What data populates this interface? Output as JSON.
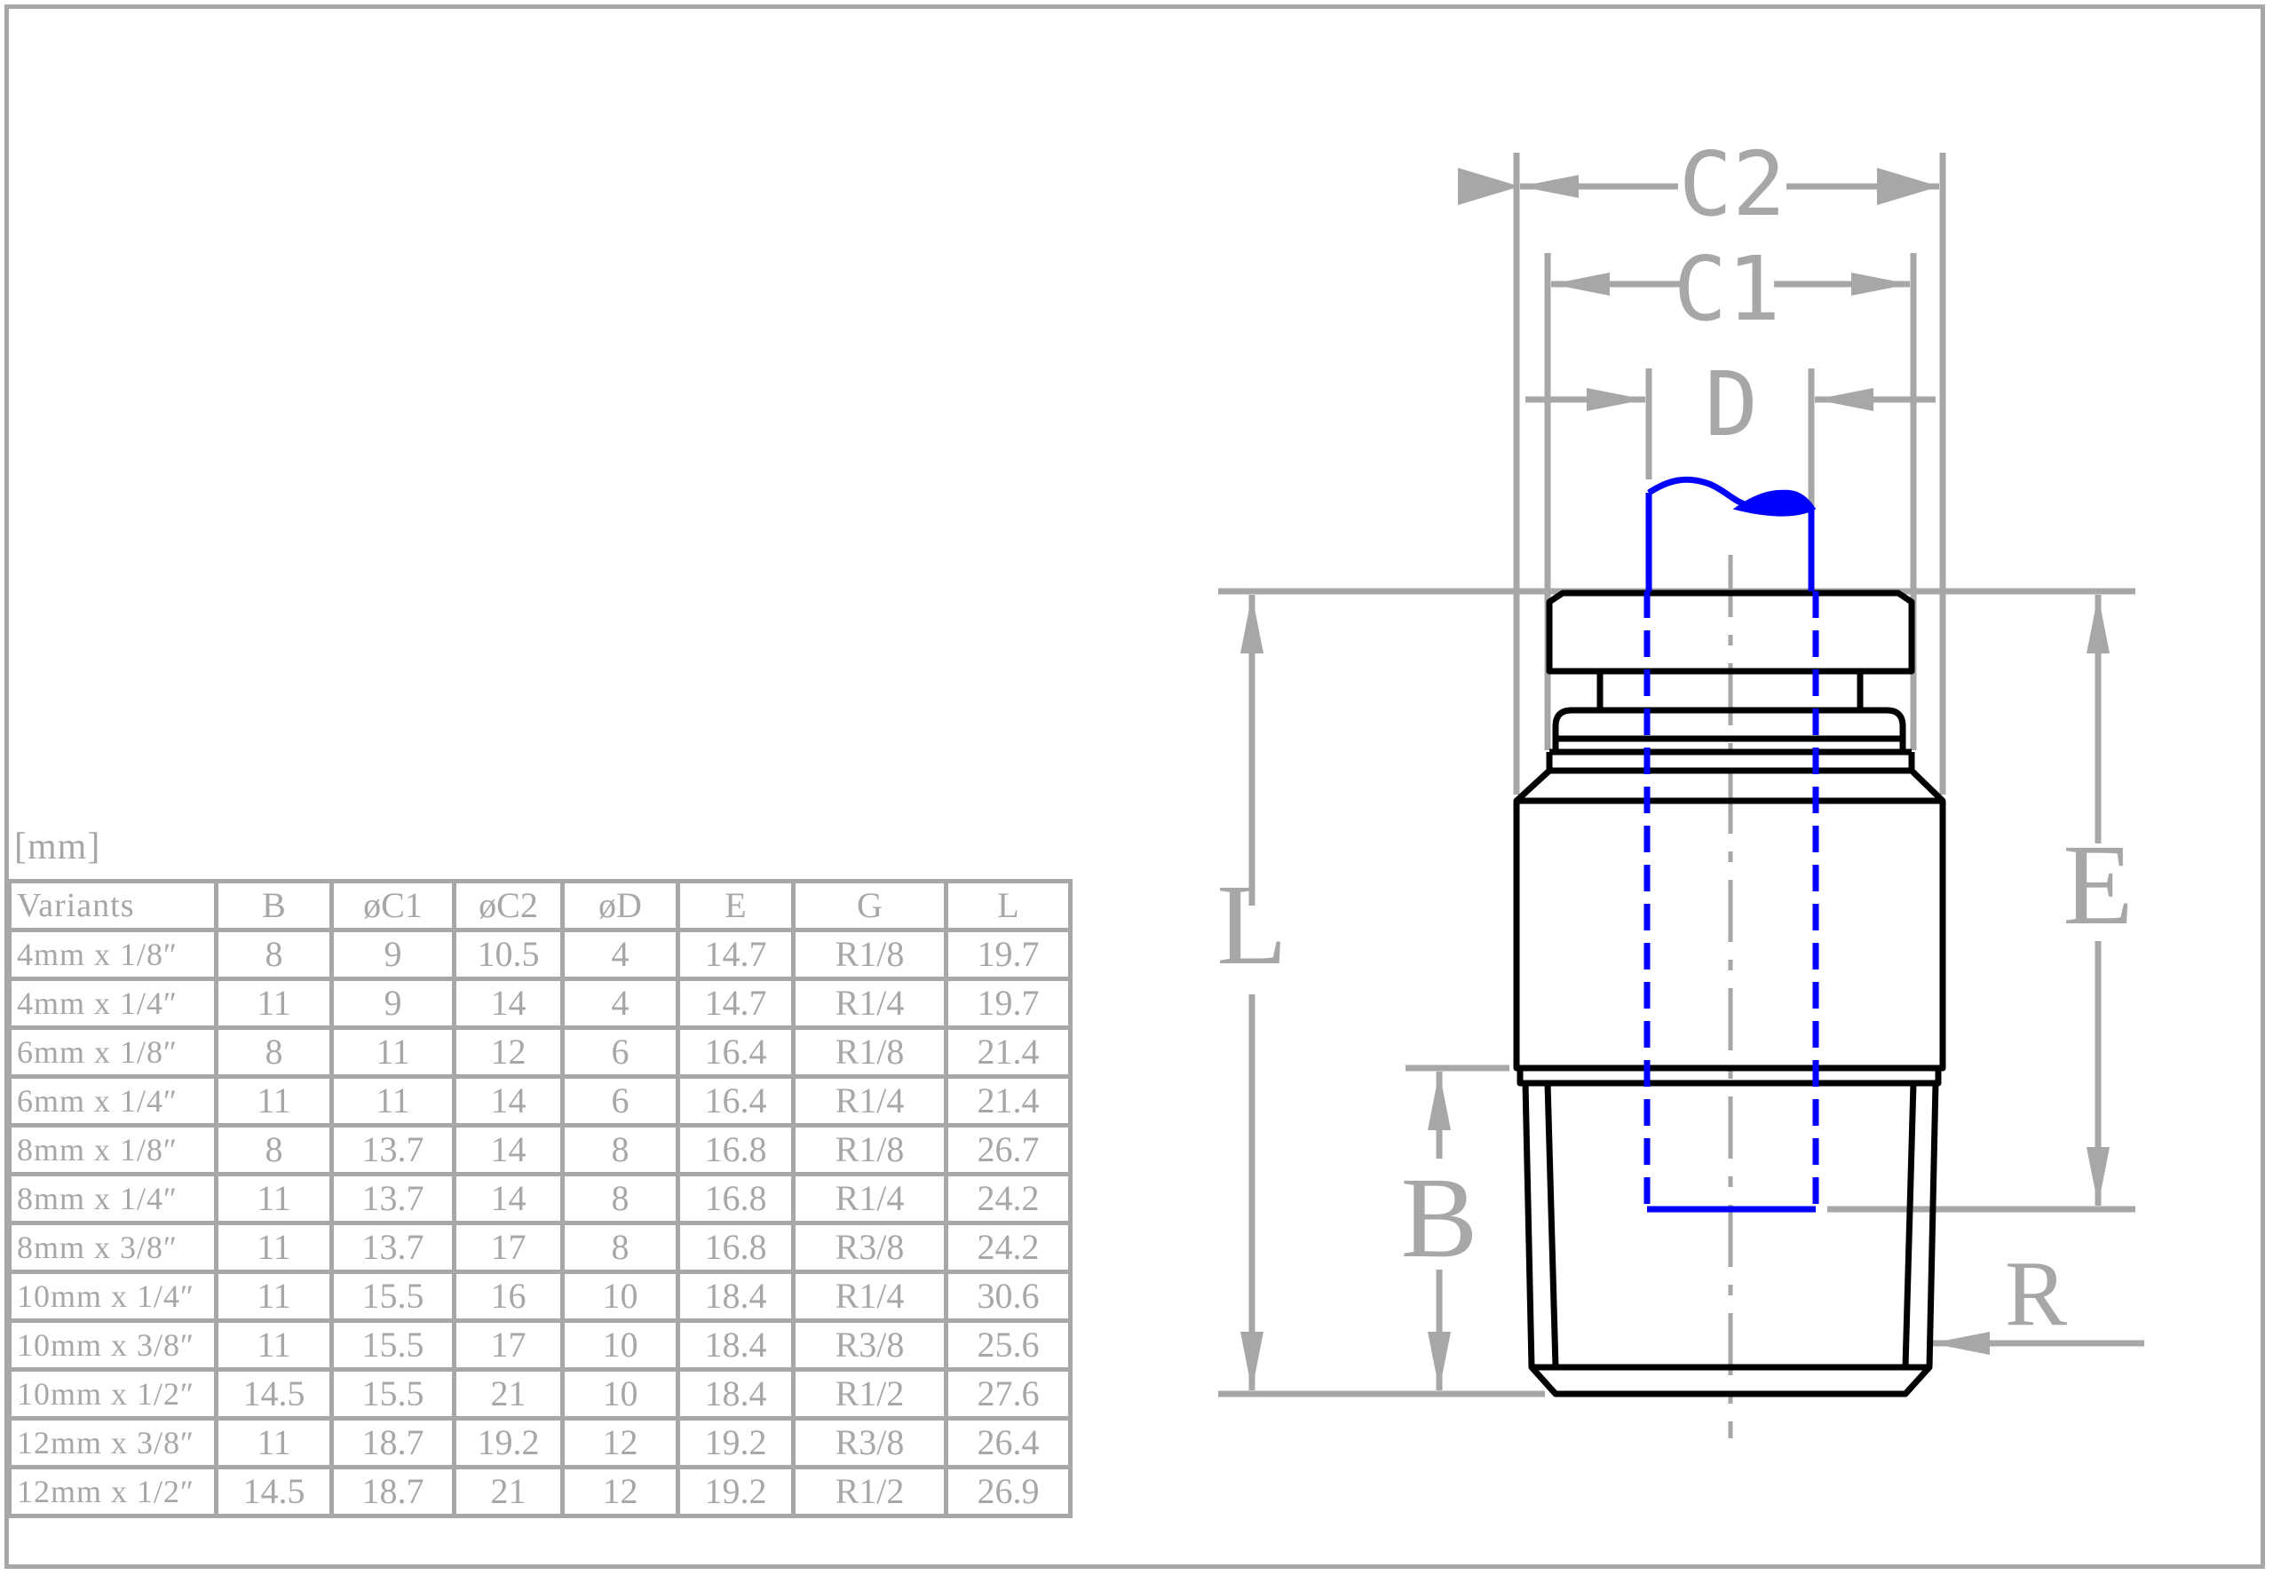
{
  "unit_label": "[mm]",
  "table": {
    "headers": [
      "Variants",
      "B",
      "øC1",
      "øC2",
      "øD",
      "E",
      "G",
      "L"
    ],
    "rows": [
      [
        "4mm x 1/8″",
        "8",
        "9",
        "10.5",
        "4",
        "14.7",
        "R1/8",
        "19.7"
      ],
      [
        "4mm x 1/4″",
        "11",
        "9",
        "14",
        "4",
        "14.7",
        "R1/4",
        "19.7"
      ],
      [
        "6mm x 1/8″",
        "8",
        "11",
        "12",
        "6",
        "16.4",
        "R1/8",
        "21.4"
      ],
      [
        "6mm x 1/4″",
        "11",
        "11",
        "14",
        "6",
        "16.4",
        "R1/4",
        "21.4"
      ],
      [
        "8mm x 1/8″",
        "8",
        "13.7",
        "14",
        "8",
        "16.8",
        "R1/8",
        "26.7"
      ],
      [
        "8mm x 1/4″",
        "11",
        "13.7",
        "14",
        "8",
        "16.8",
        "R1/4",
        "24.2"
      ],
      [
        "8mm x 3/8″",
        "11",
        "13.7",
        "17",
        "8",
        "16.8",
        "R3/8",
        "24.2"
      ],
      [
        "10mm x 1/4″",
        "11",
        "15.5",
        "16",
        "10",
        "18.4",
        "R1/4",
        "30.6"
      ],
      [
        "10mm x 3/8″",
        "11",
        "15.5",
        "17",
        "10",
        "18.4",
        "R3/8",
        "25.6"
      ],
      [
        "10mm x 1/2″",
        "14.5",
        "15.5",
        "21",
        "10",
        "18.4",
        "R1/2",
        "27.6"
      ],
      [
        "12mm x 3/8″",
        "11",
        "18.7",
        "19.2",
        "12",
        "19.2",
        "R3/8",
        "26.4"
      ],
      [
        "12mm x 1/2″",
        "14.5",
        "18.7",
        "21",
        "12",
        "19.2",
        "R1/2",
        "26.9"
      ]
    ]
  },
  "drawing": {
    "labels": {
      "c2": "C2",
      "c1": "C1",
      "d": "D",
      "l": "L",
      "e": "E",
      "b": "B",
      "r": "R"
    },
    "colors": {
      "dimension": "#a7a7a9",
      "outline": "#000000",
      "tube": "#0000ff",
      "frame": "#a7a7a9"
    }
  }
}
